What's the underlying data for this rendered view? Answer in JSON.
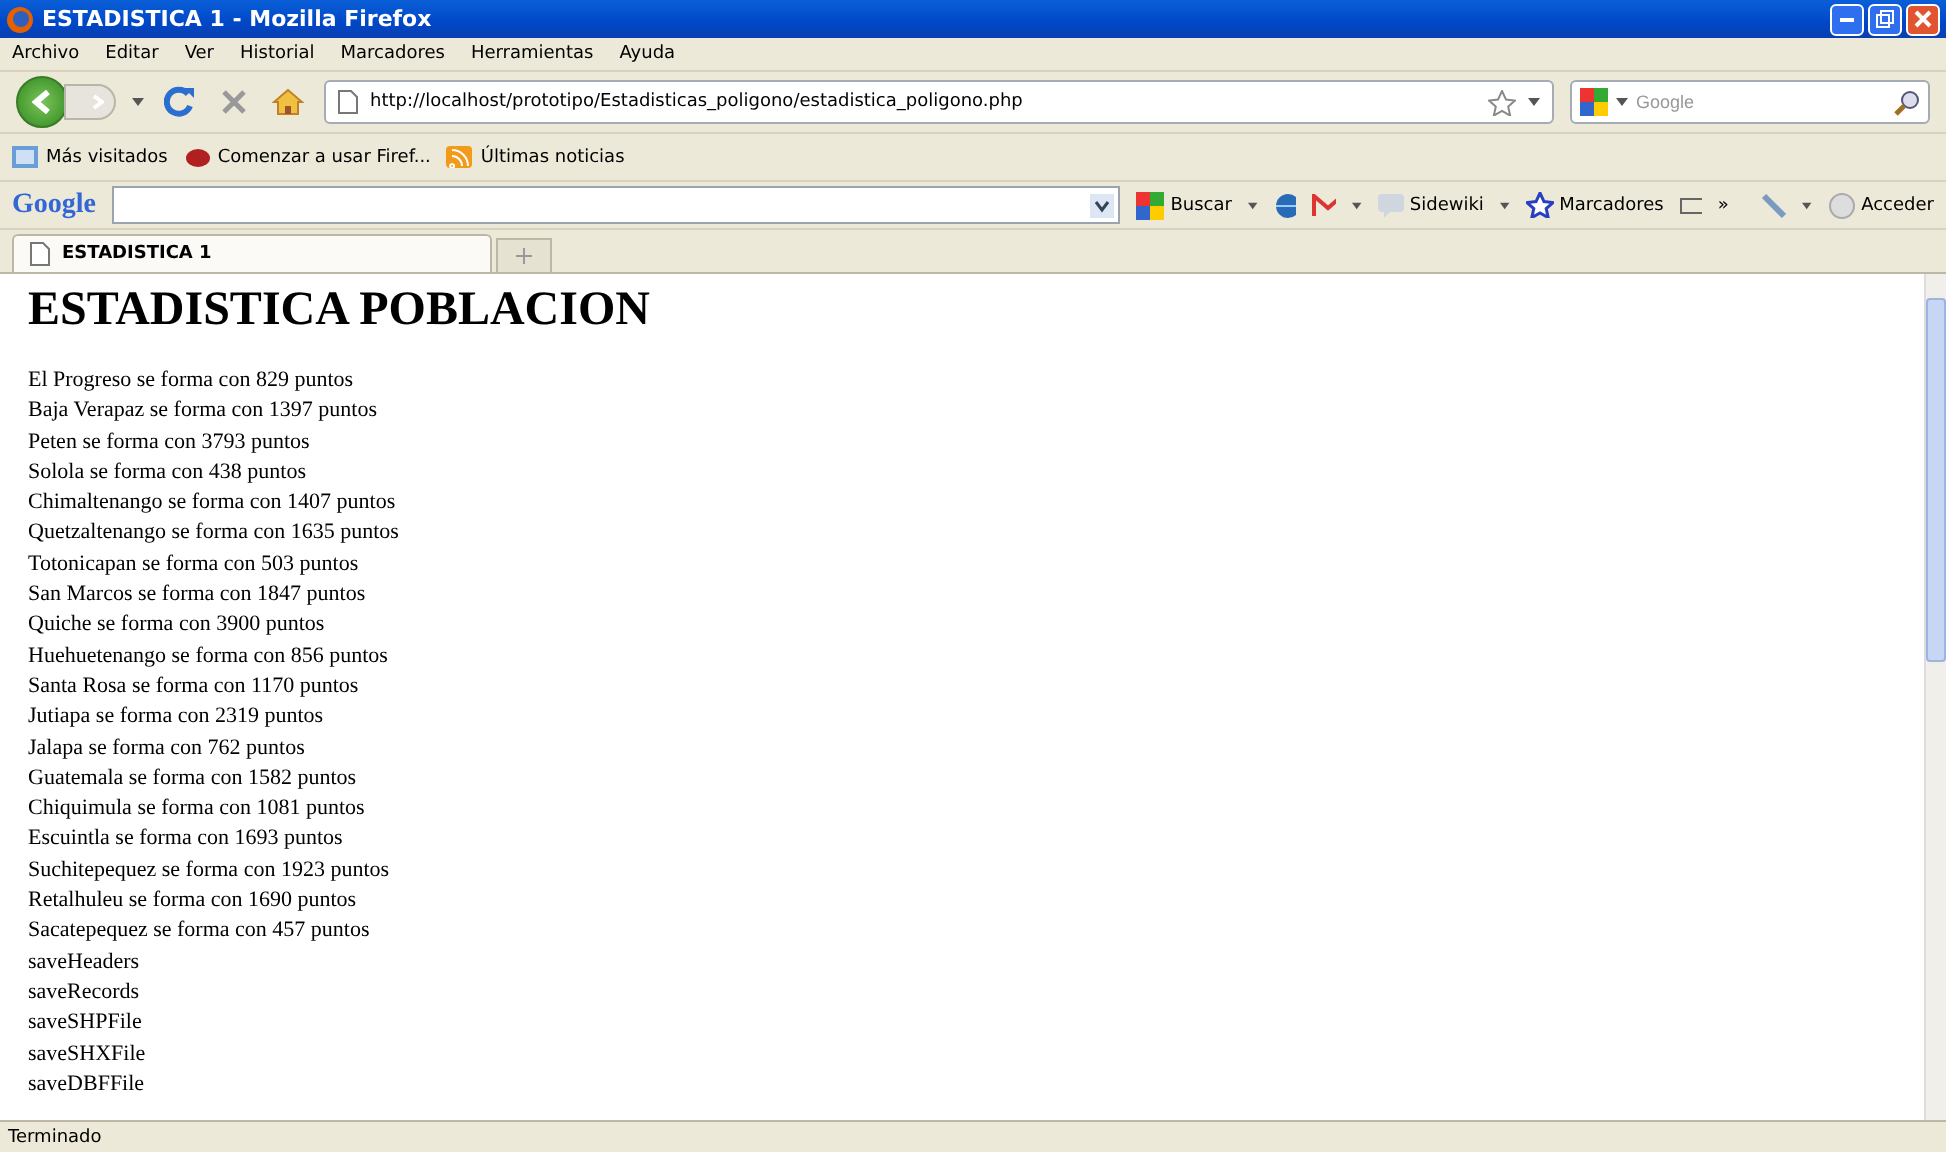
{
  "window": {
    "title": "ESTADISTICA 1 - Mozilla Firefox"
  },
  "menu": [
    "Archivo",
    "Editar",
    "Ver",
    "Historial",
    "Marcadores",
    "Herramientas",
    "Ayuda"
  ],
  "address_bar": {
    "value": "http://localhost/prototipo/Estadisticas_poligono/estadistica_poligono.php"
  },
  "search_bar": {
    "placeholder": "Google"
  },
  "bookmarks": [
    "Más visitados",
    "Comenzar a usar Firef...",
    "Últimas noticias"
  ],
  "google_toolbar": {
    "logo": "Google",
    "buttons": [
      "Buscar",
      "Sidewiki",
      "Marcadores"
    ],
    "more": "»",
    "sign_in": "Acceder"
  },
  "tabs": [
    {
      "label": "ESTADISTICA 1",
      "selected": true
    }
  ],
  "page": {
    "heading": "ESTADISTICA POBLACION",
    "lines": [
      "El Progreso se forma con 829 puntos",
      "Baja Verapaz se forma con 1397 puntos",
      "Peten se forma con 3793 puntos",
      "Solola se forma con 438 puntos",
      "Chimaltenango se forma con 1407 puntos",
      "Quetzaltenango se forma con 1635 puntos",
      "Totonicapan se forma con 503 puntos",
      "San Marcos se forma con 1847 puntos",
      "Quiche se forma con 3900 puntos",
      "Huehuetenango se forma con 856 puntos",
      "Santa Rosa se forma con 1170 puntos",
      "Jutiapa se forma con 2319 puntos",
      "Jalapa se forma con 762 puntos",
      "Guatemala se forma con 1582 puntos",
      "Chiquimula se forma con 1081 puntos",
      "Escuintla se forma con 1693 puntos",
      "Suchitepequez se forma con 1923 puntos",
      "Retalhuleu se forma con 1690 puntos",
      "Sacatepequez se forma con 457 puntos",
      "saveHeaders",
      "saveRecords",
      "saveSHPFile",
      "saveSHXFile",
      "saveDBFFile"
    ]
  },
  "status_bar": {
    "text": "Terminado"
  }
}
